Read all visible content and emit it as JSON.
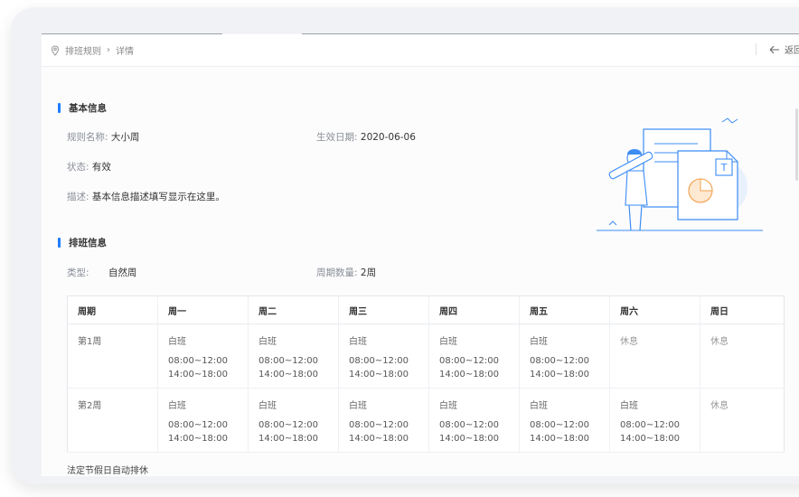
{
  "breadcrumb": {
    "items": [
      "排班规则",
      "详情"
    ]
  },
  "header": {
    "back_label": "返回"
  },
  "basic_info": {
    "title": "基本信息",
    "rule_name_label": "规则名称:",
    "rule_name": "大小周",
    "effective_date_label": "生效日期:",
    "effective_date": "2020-06-06",
    "status_label": "状态:",
    "status": "有效",
    "desc_label": "描述:",
    "desc": "基本信息描述填写显示在这里。"
  },
  "schedule_info": {
    "title": "排班信息",
    "type_label": "类型:",
    "type": "自然周",
    "cycle_count_label": "周期数量:",
    "cycle_count": "2周"
  },
  "table": {
    "headers": [
      "周期",
      "周一",
      "周二",
      "周三",
      "周四",
      "周五",
      "周六",
      "周日"
    ],
    "rows": [
      {
        "week": "第1周",
        "days": [
          {
            "shift": "白班",
            "t1": "08:00~12:00",
            "t2": "14:00~18:00"
          },
          {
            "shift": "白班",
            "t1": "08:00~12:00",
            "t2": "14:00~18:00"
          },
          {
            "shift": "白班",
            "t1": "08:00~12:00",
            "t2": "14:00~18:00"
          },
          {
            "shift": "白班",
            "t1": "08:00~12:00",
            "t2": "14:00~18:00"
          },
          {
            "shift": "白班",
            "t1": "08:00~12:00",
            "t2": "14:00~18:00"
          },
          {
            "rest": "休息"
          },
          {
            "rest": "休息"
          }
        ]
      },
      {
        "week": "第2周",
        "days": [
          {
            "shift": "白班",
            "t1": "08:00~12:00",
            "t2": "14:00~18:00"
          },
          {
            "shift": "白班",
            "t1": "08:00~12:00",
            "t2": "14:00~18:00"
          },
          {
            "shift": "白班",
            "t1": "08:00~12:00",
            "t2": "14:00~18:00"
          },
          {
            "shift": "白班",
            "t1": "08:00~12:00",
            "t2": "14:00~18:00"
          },
          {
            "shift": "白班",
            "t1": "08:00~12:00",
            "t2": "14:00~18:00"
          },
          {
            "shift": "白班",
            "t1": "08:00~12:00",
            "t2": "14:00~18:00"
          },
          {
            "rest": "休息"
          }
        ]
      }
    ]
  },
  "footnote": "法定节假日自动排休",
  "illustration": {
    "sign_letter": "T"
  },
  "colors": {
    "accent": "#1f7dff",
    "illustration_line": "#3b8cf5",
    "illustration_fill": "#e8f1fd",
    "chart_orange": "#f5a04a"
  }
}
